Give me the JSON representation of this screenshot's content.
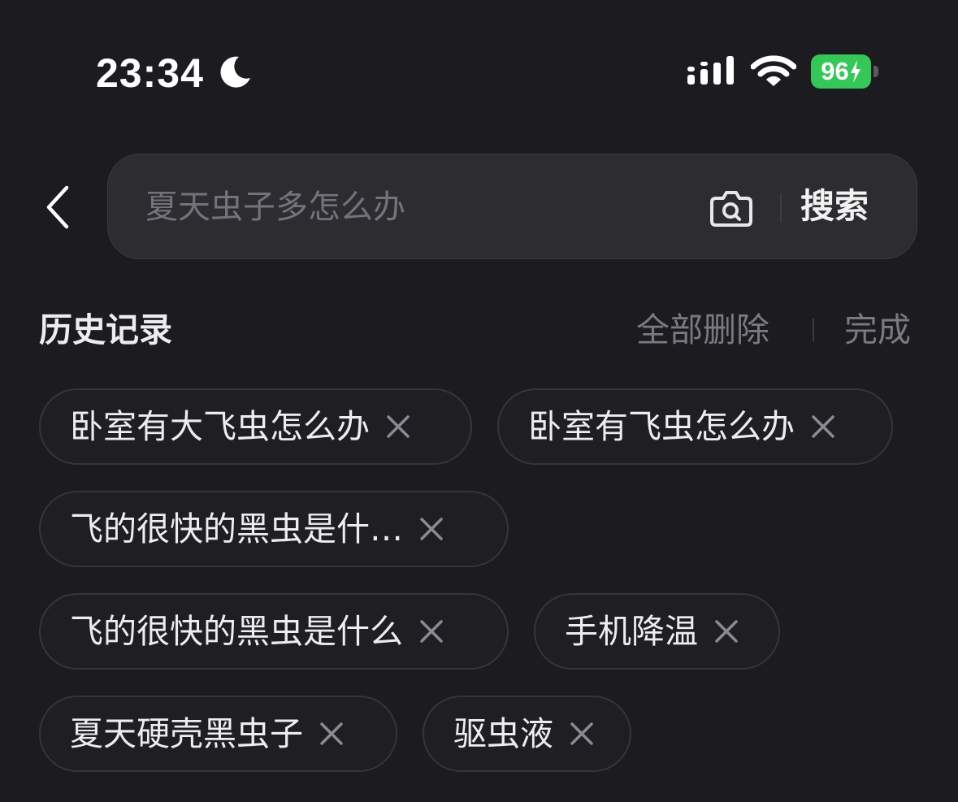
{
  "status_bar": {
    "time": "23:34",
    "battery_level": "96",
    "icons": [
      "moon-icon",
      "signal-icon",
      "wifi-icon",
      "battery-icon",
      "bolt-icon"
    ],
    "battery_color": "#36c759"
  },
  "search": {
    "back_icon": "chevron-left-icon",
    "placeholder": "夏天虫子多怎么办",
    "camera_icon": "camera-icon",
    "button_label": "搜索"
  },
  "history": {
    "title": "历史记录",
    "delete_all_label": "全部删除",
    "done_label": "完成",
    "close_icon": "close-icon",
    "items": [
      {
        "label": "卧室有大飞虫怎么办"
      },
      {
        "label": "卧室有飞虫怎么办"
      },
      {
        "label": "飞的很快的黑虫是什…"
      },
      {
        "label": "飞的很快的黑虫是什么"
      },
      {
        "label": "手机降温"
      },
      {
        "label": "夏天硬壳黑虫子"
      },
      {
        "label": "驱虫液"
      }
    ]
  },
  "colors": {
    "background": "#1b1b20",
    "search_box": "#2c2c31",
    "muted_text": "#7a7a80",
    "chip_border": "#35353b"
  }
}
